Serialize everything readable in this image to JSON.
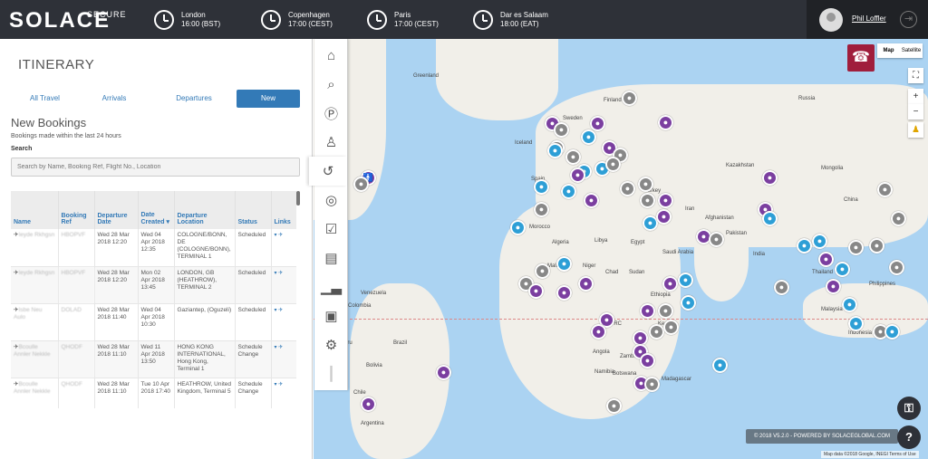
{
  "header": {
    "brand": "SOLACE",
    "brand_sub": "SECURE",
    "clocks": [
      {
        "city": "London",
        "time": "16:00 (BST)"
      },
      {
        "city": "Copenhagen",
        "time": "17:00 (CEST)"
      },
      {
        "city": "Paris",
        "time": "17:00 (CEST)"
      },
      {
        "city": "Dar es Salaam",
        "time": "18:00 (EAT)"
      }
    ],
    "user_name": "Phil Loffler",
    "logout_icon": "logout-icon"
  },
  "panel": {
    "title": "ITINERARY",
    "tabs": [
      "All Travel",
      "Arrivals",
      "Departures",
      "New"
    ],
    "active_tab": "New",
    "heading": "New Bookings",
    "subheading": "Bookings made within the last 24 hours",
    "search_label": "Search",
    "search_placeholder": "Search by Name, Booking Ref, Flight No., Location",
    "columns": [
      "Name",
      "Booking Ref",
      "Departure Date",
      "Date Created",
      "Departure Location",
      "Status",
      "Links"
    ],
    "rows": [
      {
        "name": "Ieyde Rkhgsn",
        "ref": "HBOPVF",
        "dep": "Wed 28 Mar 2018 12:20",
        "created": "Wed 04 Apr 2018 12:35",
        "loc": "COLOGNE/BONN, DE (COLOGNE/BONN), TERMINAL 1",
        "status": "Scheduled"
      },
      {
        "name": "Ieyde Rkhgsn",
        "ref": "HBOPVF",
        "dep": "Wed 28 Mar 2018 12:20",
        "created": "Mon 02 Apr 2018 13:45",
        "loc": "LONDON, GB (HEATHROW), TERMINAL 2",
        "status": "Scheduled"
      },
      {
        "name": "Isbe Neu Aulo",
        "ref": "DOLAD",
        "dep": "Wed 28 Mar 2018 11:40",
        "created": "Wed 04 Apr 2018 10:30",
        "loc": "Gaziantep, (Oguzeli)",
        "status": "Scheduled"
      },
      {
        "name": "Bcoulle Annler Nekkle",
        "ref": "QHODF",
        "dep": "Wed 28 Mar 2018 11:10",
        "created": "Wed 11 Apr 2018 13:50",
        "loc": "HONG KONG INTERNATIONAL, Hong Kong, Terminal 1",
        "status": "Schedule Change"
      },
      {
        "name": "Bcoulle Annler Nekkle",
        "ref": "QHODF",
        "dep": "Wed 28 Mar 2018 11:10",
        "created": "Tue 10 Apr 2018 17:40",
        "loc": "HEATHROW, United Kingdom, Terminal 5",
        "status": "Schedule Change"
      }
    ]
  },
  "sidebar_icons": [
    "home-icon",
    "search-icon",
    "passport-icon",
    "traveller-icon",
    "history-icon",
    "globe-icon",
    "checklist-icon",
    "contacts-icon",
    "bar-chart-icon",
    "newspaper-icon",
    "settings-icon",
    "drag-handle-icon"
  ],
  "map": {
    "map_type": [
      "Map",
      "Satellite"
    ],
    "labels": [
      "Greenland",
      "Iceland",
      "Finland",
      "Russia",
      "Sweden",
      "Kazakhstan",
      "Mongolia",
      "Spain",
      "Turkey",
      "China",
      "Iran",
      "Afghanistan",
      "Morocco",
      "Algeria",
      "Libya",
      "Egypt",
      "Saudi Arabia",
      "Pakistan",
      "India",
      "Mali",
      "Niger",
      "Chad",
      "Sudan",
      "Ethiopia",
      "Thailand",
      "Philippines",
      "Venezuela",
      "Colombia",
      "Kenya",
      "Malaysia",
      "Indonesia",
      "Brazil",
      "Peru",
      "Bolivia",
      "Angola",
      "Zambia",
      "Namibia",
      "Botswana",
      "Madagascar",
      "Chile",
      "Argentina",
      "DRC"
    ],
    "footer": "© 2018 V5.2.0 - POWERED BY SOLACEGLOBAL.COM",
    "attribution": "Map data ©2018 Google, INEGI  Terms of Use"
  },
  "colors": {
    "header": "#2e3138",
    "accent": "#337ab7",
    "phone": "#a01e3c",
    "pin_purple": "#7b3fa0",
    "pin_blue": "#2e9fd6",
    "pin_grey": "#888888"
  }
}
